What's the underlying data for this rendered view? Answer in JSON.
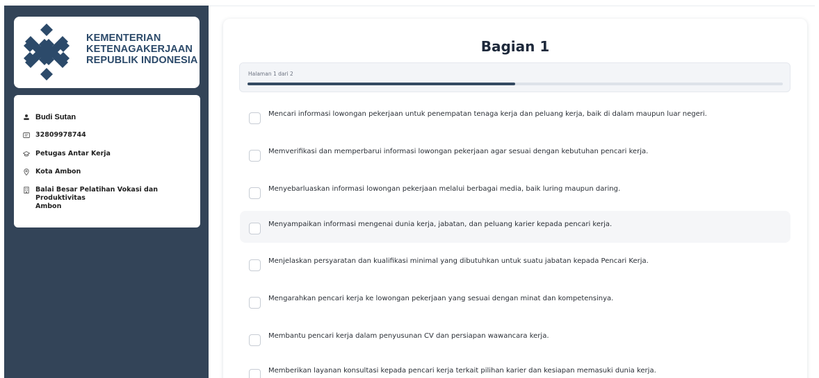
{
  "brand": {
    "line1": "KEMENTERIAN",
    "line2": "KETENAGAKERJAAN",
    "line3": "REPUBLIK INDONESIA",
    "logo_color": "#2c4a6a"
  },
  "profile": {
    "name": "Budi Sutan",
    "id_number": "32809978744",
    "role": "Petugas Antar Kerja",
    "city": "Kota Ambon",
    "institution_line1": "Balai Besar Pelatihan Vokasi dan Produktivitas",
    "institution_line2": "Ambon"
  },
  "form": {
    "title": "Bagian 1",
    "page_indicator": "Halaman 1 dari 2",
    "progress_fraction": 0.5,
    "options": [
      "Mencari informasi lowongan pekerjaan untuk penempatan tenaga kerja dan peluang kerja, baik di dalam maupun luar negeri.",
      "Memverifikasi dan memperbarui informasi lowongan pekerjaan agar sesuai dengan kebutuhan pencari kerja.",
      "Menyebarluaskan informasi lowongan pekerjaan melalui berbagai media, baik luring maupun daring.",
      "Menyampaikan informasi mengenai dunia kerja, jabatan, dan peluang karier kepada pencari kerja.",
      "Menjelaskan persyaratan dan kualifikasi minimal yang dibutuhkan untuk suatu jabatan kepada Pencari Kerja.",
      "Mengarahkan pencari kerja ke lowongan pekerjaan yang sesuai dengan minat dan kompetensinya.",
      "Membantu pencari kerja dalam penyusunan CV dan persiapan wawancara kerja.",
      "Memberikan layanan konsultasi kepada pencari kerja terkait pilihan karier dan kesiapan memasuki dunia kerja."
    ]
  },
  "colors": {
    "sidebar_bg": "#334458",
    "progress_fill": "#344a62",
    "accent_text": "#2c4a6a"
  },
  "icons": [
    "user-icon",
    "id-card-icon",
    "graduation-cap-icon",
    "location-pin-icon",
    "building-icon"
  ]
}
